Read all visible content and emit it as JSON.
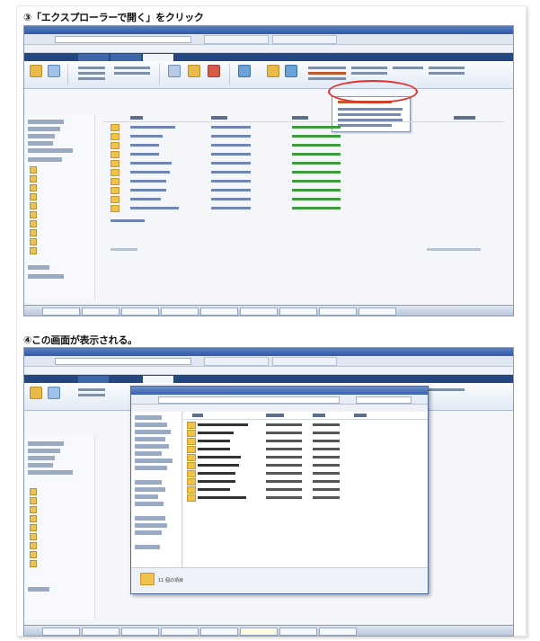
{
  "steps": [
    {
      "title": "③「エクスプローラーで開く」をクリック"
    },
    {
      "title": "④この画面が表示される。"
    }
  ],
  "dialog": {
    "count_label": "11 個の項目"
  },
  "colors": {
    "callout": "#e2322b",
    "ribbon_active": "#e9b949",
    "sharepoint_bar": "#24477f"
  }
}
